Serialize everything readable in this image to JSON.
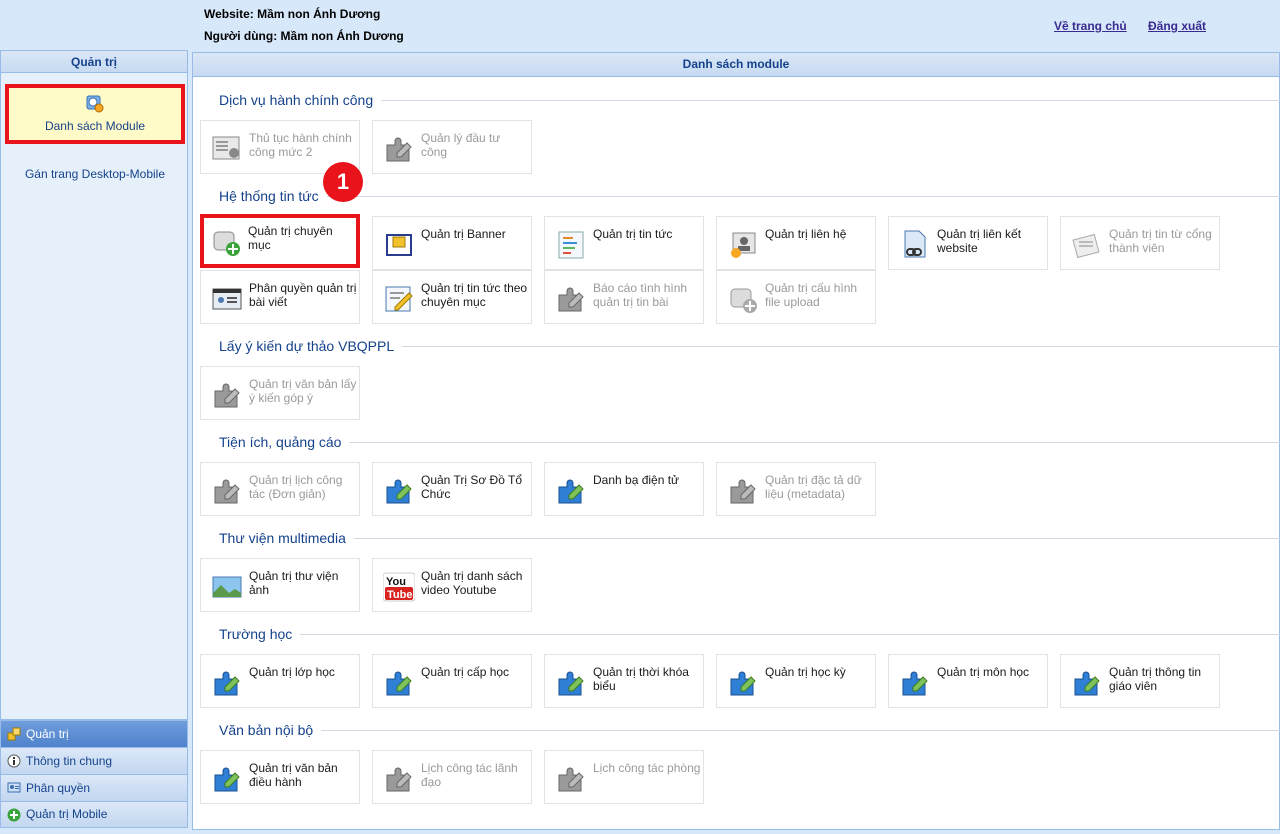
{
  "header": {
    "website": "Website: Mầm non Ánh Dương",
    "user": "Người dùng: Mầm non Ánh Dương",
    "home_link": "Về trang chủ",
    "logout_link": "Đăng xuất"
  },
  "sidebar": {
    "title": "Quản trị",
    "module_button": "Danh sách Module",
    "desktop_link": "Gán trang Desktop-Mobile"
  },
  "accordion": [
    {
      "label": "Quản trị",
      "active": true
    },
    {
      "label": "Thông tin chung",
      "active": false
    },
    {
      "label": "Phân quyền",
      "active": false
    },
    {
      "label": "Quản trị Mobile",
      "active": false
    }
  ],
  "main": {
    "title": "Danh sách module",
    "step_badge": "1",
    "sections": [
      {
        "title": "Dịch vụ hành chính công"
      },
      {
        "title": "Hệ thống tin tức"
      },
      {
        "title": "Lấy ý kiến dự thảo VBQPPL"
      },
      {
        "title": "Tiện ích, quảng cáo"
      },
      {
        "title": "Thư viện multimedia"
      },
      {
        "title": "Trường học"
      },
      {
        "title": "Văn bản nội bộ"
      }
    ],
    "tiles": [
      {
        "label": "Thủ tục hành chính công mức 2",
        "icon": "form-icon",
        "enabled": false
      },
      {
        "label": "Quản lý đầu tư công",
        "icon": "puzzle-icon",
        "enabled": false
      },
      {
        "label": "Quản trị chuyên mục",
        "icon": "scroll-add-icon",
        "enabled": true
      },
      {
        "label": "Quản trị Banner",
        "icon": "banner-icon",
        "enabled": true
      },
      {
        "label": "Quản trị tin tức",
        "icon": "news-icon",
        "enabled": true
      },
      {
        "label": "Quản trị liên hệ",
        "icon": "contact-icon",
        "enabled": true
      },
      {
        "label": "Quản trị liên kết website",
        "icon": "link-icon",
        "enabled": true
      },
      {
        "label": "Quản trị tin từ cổng thành viên",
        "icon": "docs-icon",
        "enabled": false
      },
      {
        "label": "Phân quyền quản trị bài viết",
        "icon": "idcard-icon",
        "enabled": true
      },
      {
        "label": "Quản trị tin tức theo chuyên mục",
        "icon": "edit-icon",
        "enabled": true
      },
      {
        "label": "Báo cáo tình hình quản trị tin bài",
        "icon": "puzzle-icon",
        "enabled": false
      },
      {
        "label": "Quản trị cấu hình file upload",
        "icon": "scroll-add-icon",
        "enabled": false
      },
      {
        "label": "Quản trị văn bản lấy ý kiến góp ý",
        "icon": "puzzle-icon",
        "enabled": false
      },
      {
        "label": "Quản trị lịch công tác (Đơn giản)",
        "icon": "puzzle-icon",
        "enabled": false
      },
      {
        "label": "Quản Trị Sơ Đồ Tổ Chức",
        "icon": "puzzle-icon",
        "enabled": true
      },
      {
        "label": "Danh bạ điện tử",
        "icon": "puzzle-icon",
        "enabled": true
      },
      {
        "label": "Quản trị đặc tả dữ liệu (metadata)",
        "icon": "puzzle-icon",
        "enabled": false
      },
      {
        "label": "Quản trị thư viện ảnh",
        "icon": "photo-icon",
        "enabled": true
      },
      {
        "label": "Quản trị danh sách video Youtube",
        "icon": "youtube-icon",
        "enabled": true
      },
      {
        "label": "Quản trị lớp học",
        "icon": "puzzle-icon",
        "enabled": true
      },
      {
        "label": "Quản trị cấp học",
        "icon": "puzzle-icon",
        "enabled": true
      },
      {
        "label": "Quản trị thời khóa biểu",
        "icon": "puzzle-icon",
        "enabled": true
      },
      {
        "label": "Quản trị học kỳ",
        "icon": "puzzle-icon",
        "enabled": true
      },
      {
        "label": "Quản trị môn học",
        "icon": "puzzle-icon",
        "enabled": true
      },
      {
        "label": "Quản trị thông tin giáo viên",
        "icon": "puzzle-icon",
        "enabled": true
      },
      {
        "label": "Quản trị văn bản điều hành",
        "icon": "puzzle-icon",
        "enabled": true
      },
      {
        "label": "Lịch công tác lãnh đạo",
        "icon": "puzzle-icon",
        "enabled": false
      },
      {
        "label": "Lịch công tác phòng",
        "icon": "puzzle-icon",
        "enabled": false
      }
    ],
    "colors": {
      "highlight": "#e8131b",
      "title_text": "#15428b",
      "disabled_text": "#9a9a9a"
    }
  }
}
